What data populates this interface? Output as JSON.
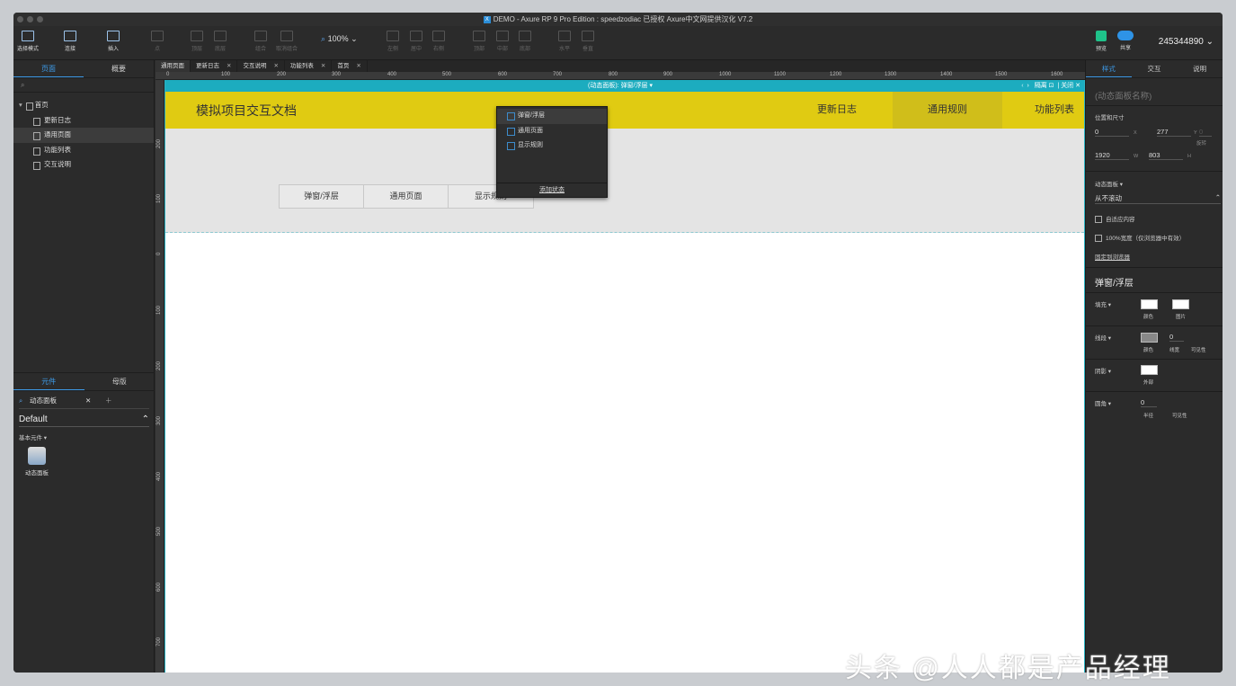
{
  "window": {
    "title": "DEMO - Axure RP 9 Pro Edition : speedzodiac 已授权      Axure中文网提供汉化 V7.2"
  },
  "toolbar": {
    "buttons": [
      {
        "name": "select-mode",
        "label": "选择模式"
      },
      {
        "name": "connect",
        "label": "连接"
      },
      {
        "name": "insert",
        "label": "插入"
      },
      {
        "name": "point",
        "label": "点"
      },
      {
        "name": "top",
        "label": "顶层"
      },
      {
        "name": "bottom",
        "label": "底层"
      },
      {
        "name": "group",
        "label": "组合"
      },
      {
        "name": "ungroup",
        "label": "取消组合"
      },
      {
        "name": "align-left",
        "label": "左侧"
      },
      {
        "name": "align-center",
        "label": "居中"
      },
      {
        "name": "align-right",
        "label": "右侧"
      },
      {
        "name": "align-top",
        "label": "顶部"
      },
      {
        "name": "align-middle",
        "label": "中部"
      },
      {
        "name": "align-bottom",
        "label": "底部"
      },
      {
        "name": "horizontal",
        "label": "水平"
      },
      {
        "name": "vertical",
        "label": "垂直"
      }
    ],
    "zoom": "100%",
    "preview": "预览",
    "share": "共享",
    "user": "245344890"
  },
  "left_panel": {
    "tabs": [
      "页面",
      "概要"
    ],
    "pages": [
      "首页",
      "更新日志",
      "通用页面",
      "功能列表",
      "交互说明"
    ],
    "lib_tabs": [
      "元件",
      "母版"
    ],
    "search": "动态面板",
    "library": "Default",
    "section": "基本元件",
    "widget": "动态面板"
  },
  "doc_tabs": [
    "通用页面",
    "更新日志",
    "交互说明",
    "功能列表",
    "首页"
  ],
  "ruler_h": [
    "0",
    "100",
    "200",
    "300",
    "400",
    "500",
    "600",
    "700",
    "800",
    "900",
    "1000",
    "1100",
    "1200",
    "1300",
    "1400",
    "1500",
    "1600"
  ],
  "ruler_v": [
    "200",
    "100",
    "0",
    "100",
    "200",
    "300",
    "400",
    "500",
    "600",
    "700"
  ],
  "dp_bar": {
    "label": "(动态面板):",
    "state": "弹窗/浮层",
    "isolate": "隔离",
    "close": "关闭"
  },
  "canvas": {
    "header_title": "模拟项目交互文档",
    "nav": [
      "更新日志",
      "通用规则",
      "功能列表"
    ],
    "buttons": [
      "弹窗/浮层",
      "通用页面",
      "显示规则"
    ]
  },
  "dropdown": {
    "options": [
      "弹窗/浮层",
      "通用页面",
      "显示规则"
    ],
    "add": "添加状态"
  },
  "right_panel": {
    "tabs": [
      "样式",
      "交互",
      "说明"
    ],
    "name_placeholder": "(动态面板名称)",
    "pos_size": "位置和尺寸",
    "x": "0",
    "x_lbl": "X",
    "y": "277",
    "y_lbl": "Y",
    "rot": "0",
    "rot_lbl": "旋转",
    "w": "1920",
    "w_lbl": "W",
    "h": "803",
    "h_lbl": "H",
    "dp_section": "动态面板",
    "scroll": "从不滚动",
    "fit": "自适应内容",
    "width100": "100%宽度（仅浏览器中有效）",
    "pin": "固定到浏览器",
    "state_title": "弹窗/浮层",
    "fill": "填充",
    "fill_color": "颜色",
    "fill_image": "图片",
    "border": "线段",
    "border_color": "颜色",
    "border_w": "0",
    "border_w_lbl": "线宽",
    "border_vis": "可见性",
    "shadow": "阴影",
    "shadow_outer": "外部",
    "radius": "圆角",
    "radius_v": "0",
    "radius_lbl": "半径",
    "radius_vis": "可见性"
  },
  "watermark": "头条 @人人都是产品经理"
}
